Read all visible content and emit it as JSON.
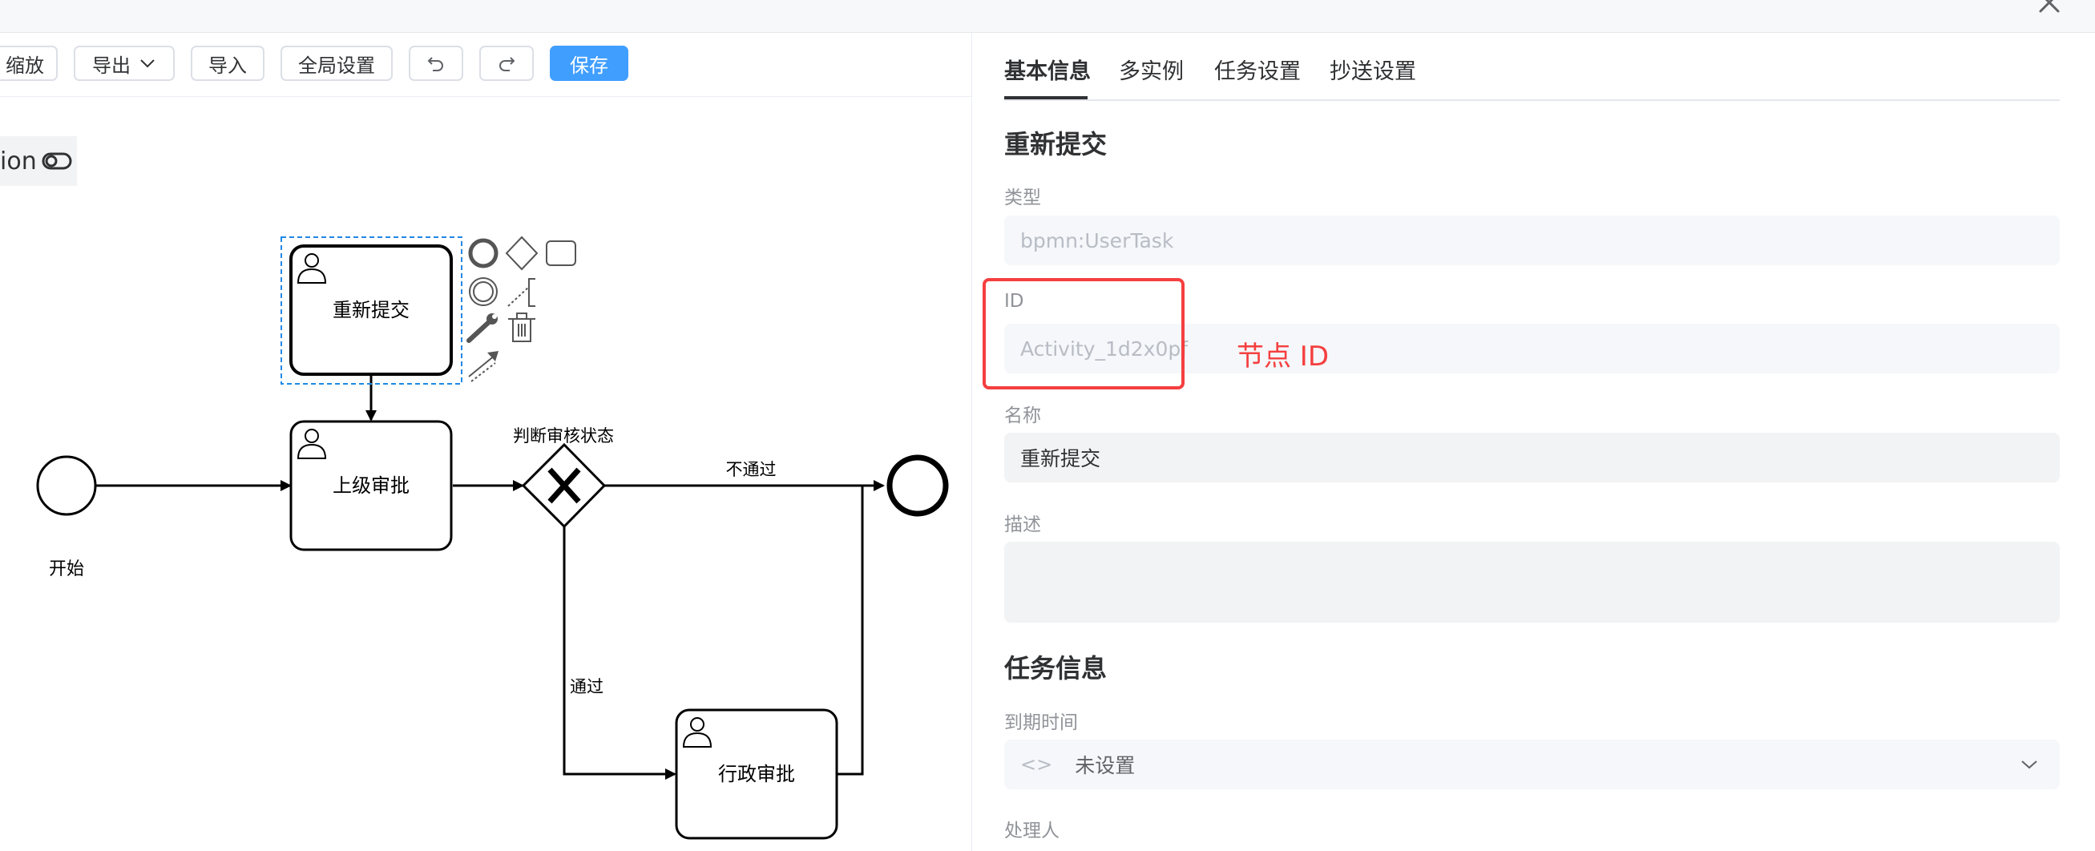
{
  "toolbar": {
    "zoom_label": "缩放",
    "export_label": "导出",
    "import_label": "导入",
    "global_settings_label": "全局设置",
    "save_label": "保存"
  },
  "canvas": {
    "toggle_label": "ion"
  },
  "diagram": {
    "start_label": "开始",
    "task_resubmit": "重新提交",
    "task_supervisor": "上级审批",
    "gateway_label": "判断审核状态",
    "flow_reject": "不通过",
    "flow_pass": "通过",
    "task_admin": "行政审批"
  },
  "panel": {
    "tabs": [
      {
        "label": "基本信息",
        "active": true
      },
      {
        "label": "多实例",
        "active": false
      },
      {
        "label": "任务设置",
        "active": false
      },
      {
        "label": "抄送设置",
        "active": false
      }
    ],
    "basic": {
      "title": "重新提交",
      "type_label": "类型",
      "type_value": "bpmn:UserTask",
      "id_label": "ID",
      "id_value": "Activity_1d2x0pf",
      "name_label": "名称",
      "name_value": "重新提交",
      "desc_label": "描述",
      "desc_value": ""
    },
    "task_info": {
      "title": "任务信息",
      "due_label": "到期时间",
      "due_value": "未设置",
      "handler_label": "处理人"
    }
  },
  "annotation": {
    "text": "节点 ID",
    "color": "#f53f3f"
  },
  "colors": {
    "primary": "#409eff",
    "selection": "#1e88e5"
  }
}
